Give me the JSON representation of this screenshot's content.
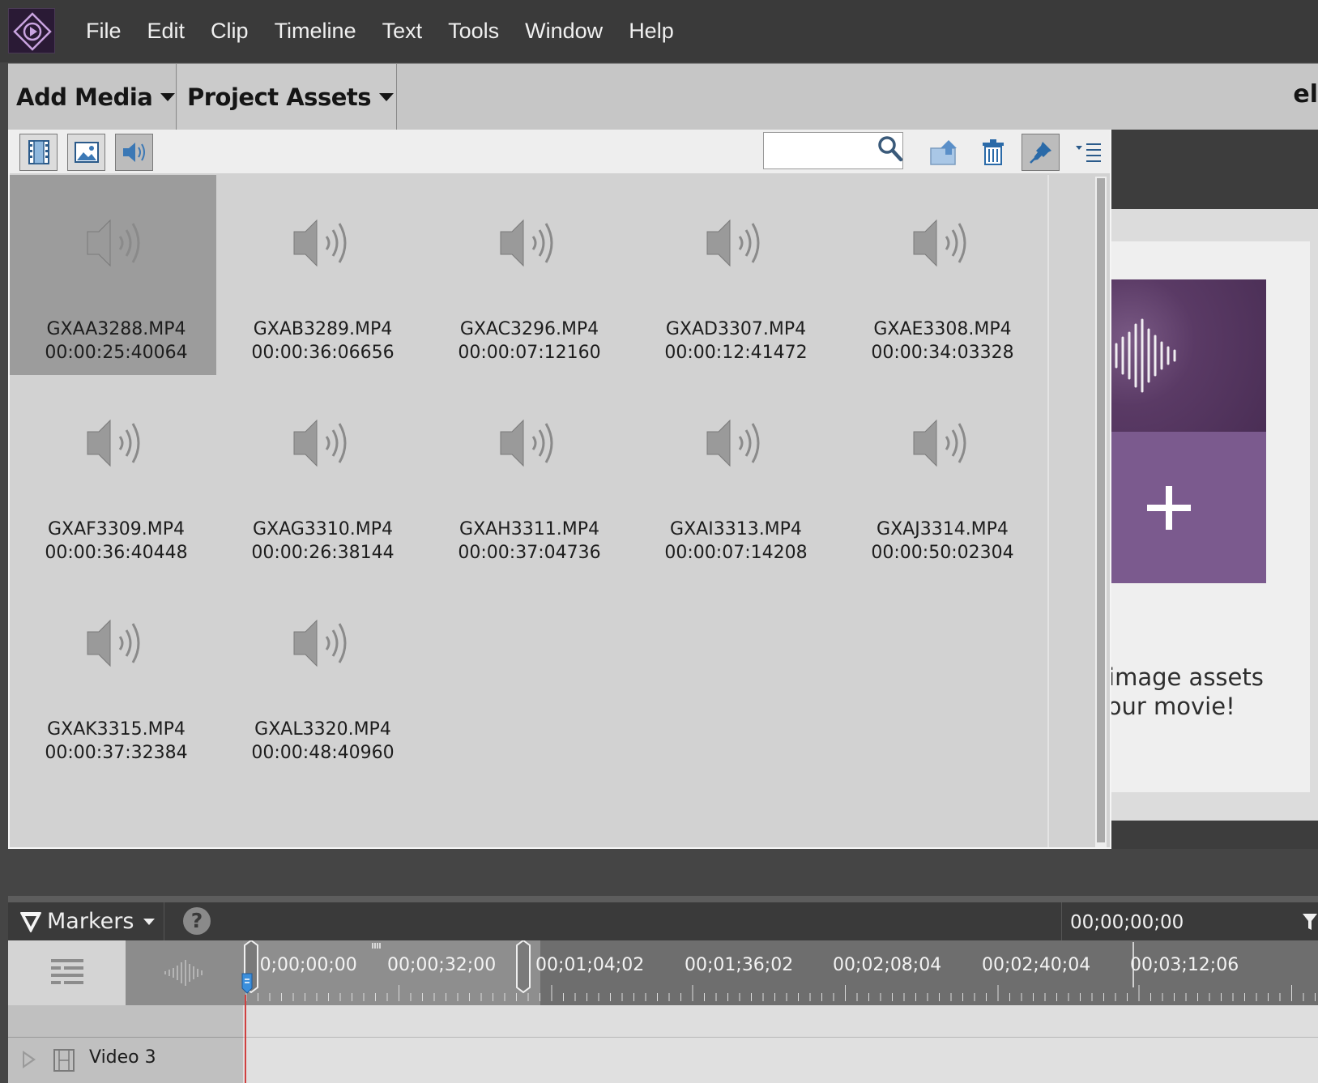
{
  "menubar": {
    "items": [
      "File",
      "Edit",
      "Clip",
      "Timeline",
      "Text",
      "Tools",
      "Window",
      "Help"
    ]
  },
  "topband": {
    "add_media": "Add Media",
    "project_assets": "Project Assets",
    "right_text": "el"
  },
  "assets_panel": {
    "search_value": "",
    "items": [
      {
        "name": "GXAA3288.MP4",
        "duration": "00:00:25:40064",
        "selected": true
      },
      {
        "name": "GXAB3289.MP4",
        "duration": "00:00:36:06656",
        "selected": false
      },
      {
        "name": "GXAC3296.MP4",
        "duration": "00:00:07:12160",
        "selected": false
      },
      {
        "name": "GXAD3307.MP4",
        "duration": "00:00:12:41472",
        "selected": false
      },
      {
        "name": "GXAE3308.MP4",
        "duration": "00:00:34:03328",
        "selected": false
      },
      {
        "name": "GXAF3309.MP4",
        "duration": "00:00:36:40448",
        "selected": false
      },
      {
        "name": "GXAG3310.MP4",
        "duration": "00:00:26:38144",
        "selected": false
      },
      {
        "name": "GXAH3311.MP4",
        "duration": "00:00:37:04736",
        "selected": false
      },
      {
        "name": "GXAI3313.MP4",
        "duration": "00:00:07:14208",
        "selected": false
      },
      {
        "name": "GXAJ3314.MP4",
        "duration": "00:00:50:02304",
        "selected": false
      },
      {
        "name": "GXAK3315.MP4",
        "duration": "00:00:37:32384",
        "selected": false
      },
      {
        "name": "GXAL3320.MP4",
        "duration": "00:00:48:40960",
        "selected": false
      }
    ]
  },
  "promo": {
    "line1": "nd image assets",
    "line2": "h your movie!"
  },
  "timeline": {
    "markers_label": "Markers",
    "help_label": "?",
    "timecode": "00;00;00;00",
    "ruler_labels": [
      ")0;00;00;00",
      "00;00;32;00",
      "00;01;04;02",
      "00;01;36;02",
      "00;02;08;04",
      "00;02;40;04",
      "00;03;12;06"
    ],
    "track_name": "Video 3"
  },
  "colors": {
    "menubar_bg": "#3a3a3a",
    "panel_bg": "#d2d2d2",
    "selected_cell": "#9c9c9c",
    "promo_purple": "#7b5a8e",
    "playhead": "#d04040"
  }
}
